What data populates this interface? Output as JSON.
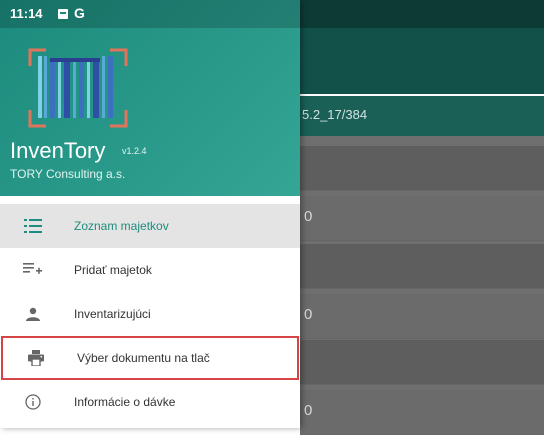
{
  "status_bar": {
    "time": "11:14",
    "carrier_icon": "G"
  },
  "drawer": {
    "app_name": "InvenTory",
    "version": "v1.2.4",
    "company": "TORY Consulting a.s.",
    "logo_icon": "barcode-scanner-logo",
    "menu": [
      {
        "label": "Zoznam majetkov",
        "icon": "list-icon",
        "active": true
      },
      {
        "label": "Pridať majetok",
        "icon": "playlist-add-icon",
        "active": false
      },
      {
        "label": "Inventarizujúci",
        "icon": "person-icon",
        "active": false
      },
      {
        "label": "Výber dokumentu na tlač",
        "icon": "printer-icon",
        "active": false,
        "highlighted": true
      },
      {
        "label": "Informácie o dávke",
        "icon": "info-icon",
        "active": false
      }
    ]
  },
  "background": {
    "batch_text": "5.2_17/384",
    "rows": [
      "0",
      "0",
      "0"
    ]
  },
  "colors": {
    "primary": "#1c8b7d",
    "active_text": "#1e8c7e",
    "highlight_border": "#d64545"
  }
}
